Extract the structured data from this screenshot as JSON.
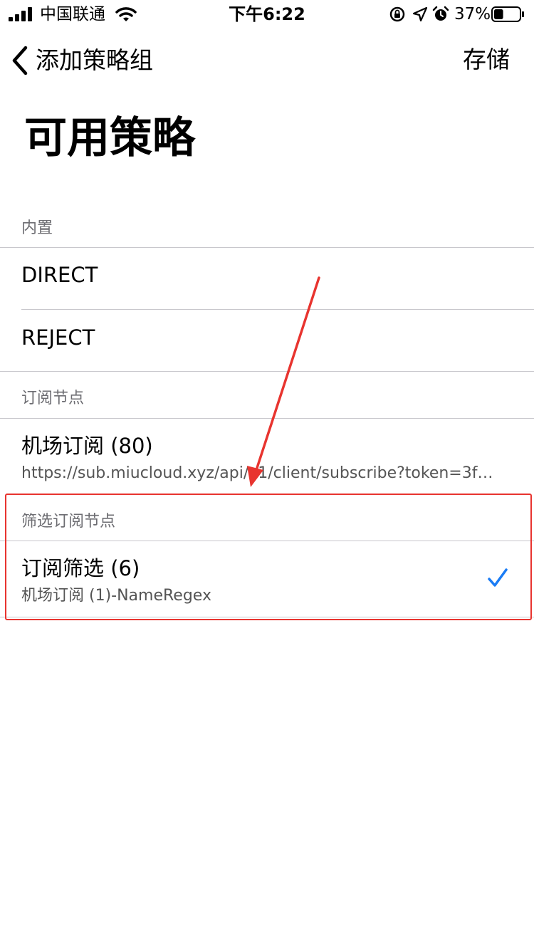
{
  "status_bar": {
    "carrier": "中国联通",
    "time": "下午6:22",
    "battery_percent_text": "37%",
    "battery_level": 0.37,
    "icons": [
      "signal-icon",
      "wifi-icon",
      "rotation-lock-icon",
      "location-icon",
      "alarm-icon",
      "battery-icon"
    ]
  },
  "nav": {
    "back_label": "添加策略组",
    "save_label": "存储"
  },
  "page_title": "可用策略",
  "sections": {
    "builtin": {
      "header": "内置",
      "items": [
        "DIRECT",
        "REJECT"
      ]
    },
    "subscription": {
      "header": "订阅节点",
      "item_title": "机场订阅 (80)",
      "item_subtitle": "https://sub.miucloud.xyz/api/v1/client/subscribe?token=3f…"
    },
    "filtered": {
      "header": "筛选订阅节点",
      "item_title": "订阅筛选 (6)",
      "item_subtitle": "机场订阅 (1)-NameRegex",
      "selected": true
    }
  },
  "colors": {
    "accent": "#1a7cf5",
    "annotation": "#e8342f",
    "separator": "#c8c7cc",
    "section_header": "#6d6d72"
  }
}
